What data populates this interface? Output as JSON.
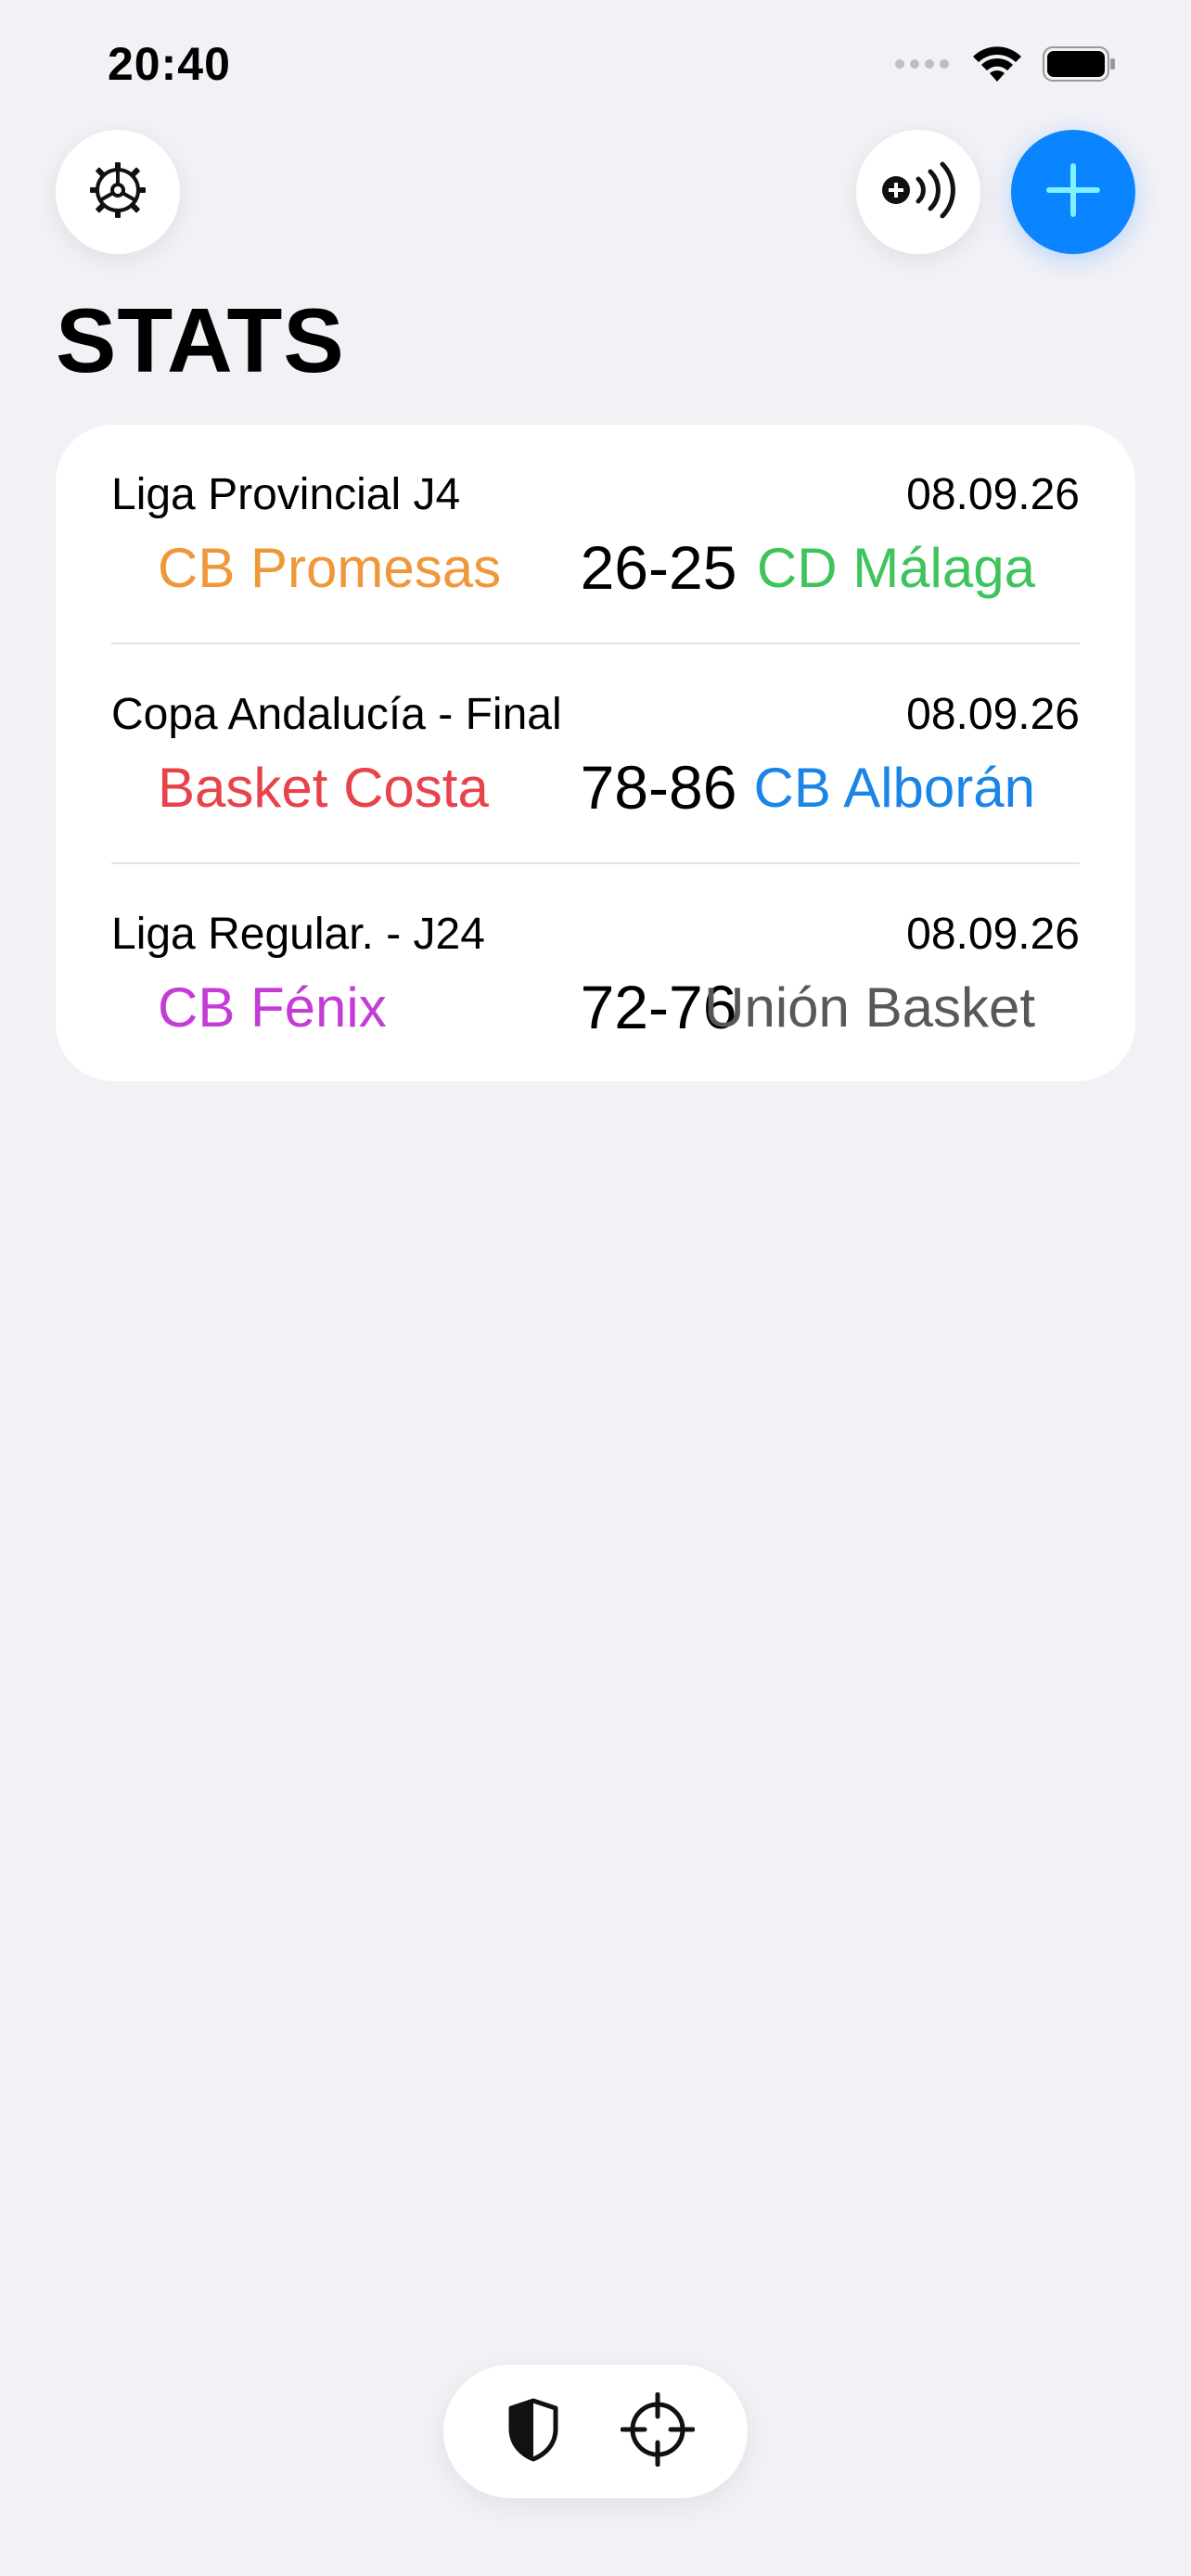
{
  "status_bar": {
    "time": "20:40",
    "icons": [
      "signal-dots-icon",
      "wifi-icon",
      "battery-icon"
    ]
  },
  "toolbar": {
    "settings_icon": "gear-icon",
    "nfc_icon": "add-nfc-icon",
    "add_icon": "plus-icon"
  },
  "page": {
    "title": "STATS"
  },
  "matches": [
    {
      "name": "Liga Provincial J4",
      "date": "08.09.26",
      "home": "CB Promesas",
      "home_color": "#f0973a",
      "score": "26-25",
      "away": "CD Málaga",
      "away_color": "#3dc45c"
    },
    {
      "name": "Copa Andalucía - Final",
      "date": "08.09.26",
      "home": "Basket Costa",
      "home_color": "#e8424a",
      "score": "78-86",
      "away": "CB Alborán",
      "away_color": "#1a85e6"
    },
    {
      "name": "Liga Regular. - J24",
      "date": "08.09.26",
      "home": "CB Fénix",
      "home_color": "#c43cd6",
      "score": "72-76",
      "away": "Unión Basket",
      "away_color": "#58585c"
    }
  ],
  "bottom_bar": {
    "tabs": [
      {
        "icon": "shield-icon"
      },
      {
        "icon": "crosshair-icon"
      }
    ]
  },
  "colors": {
    "accent": "#0a84ff",
    "background": "#f1f1f6"
  }
}
